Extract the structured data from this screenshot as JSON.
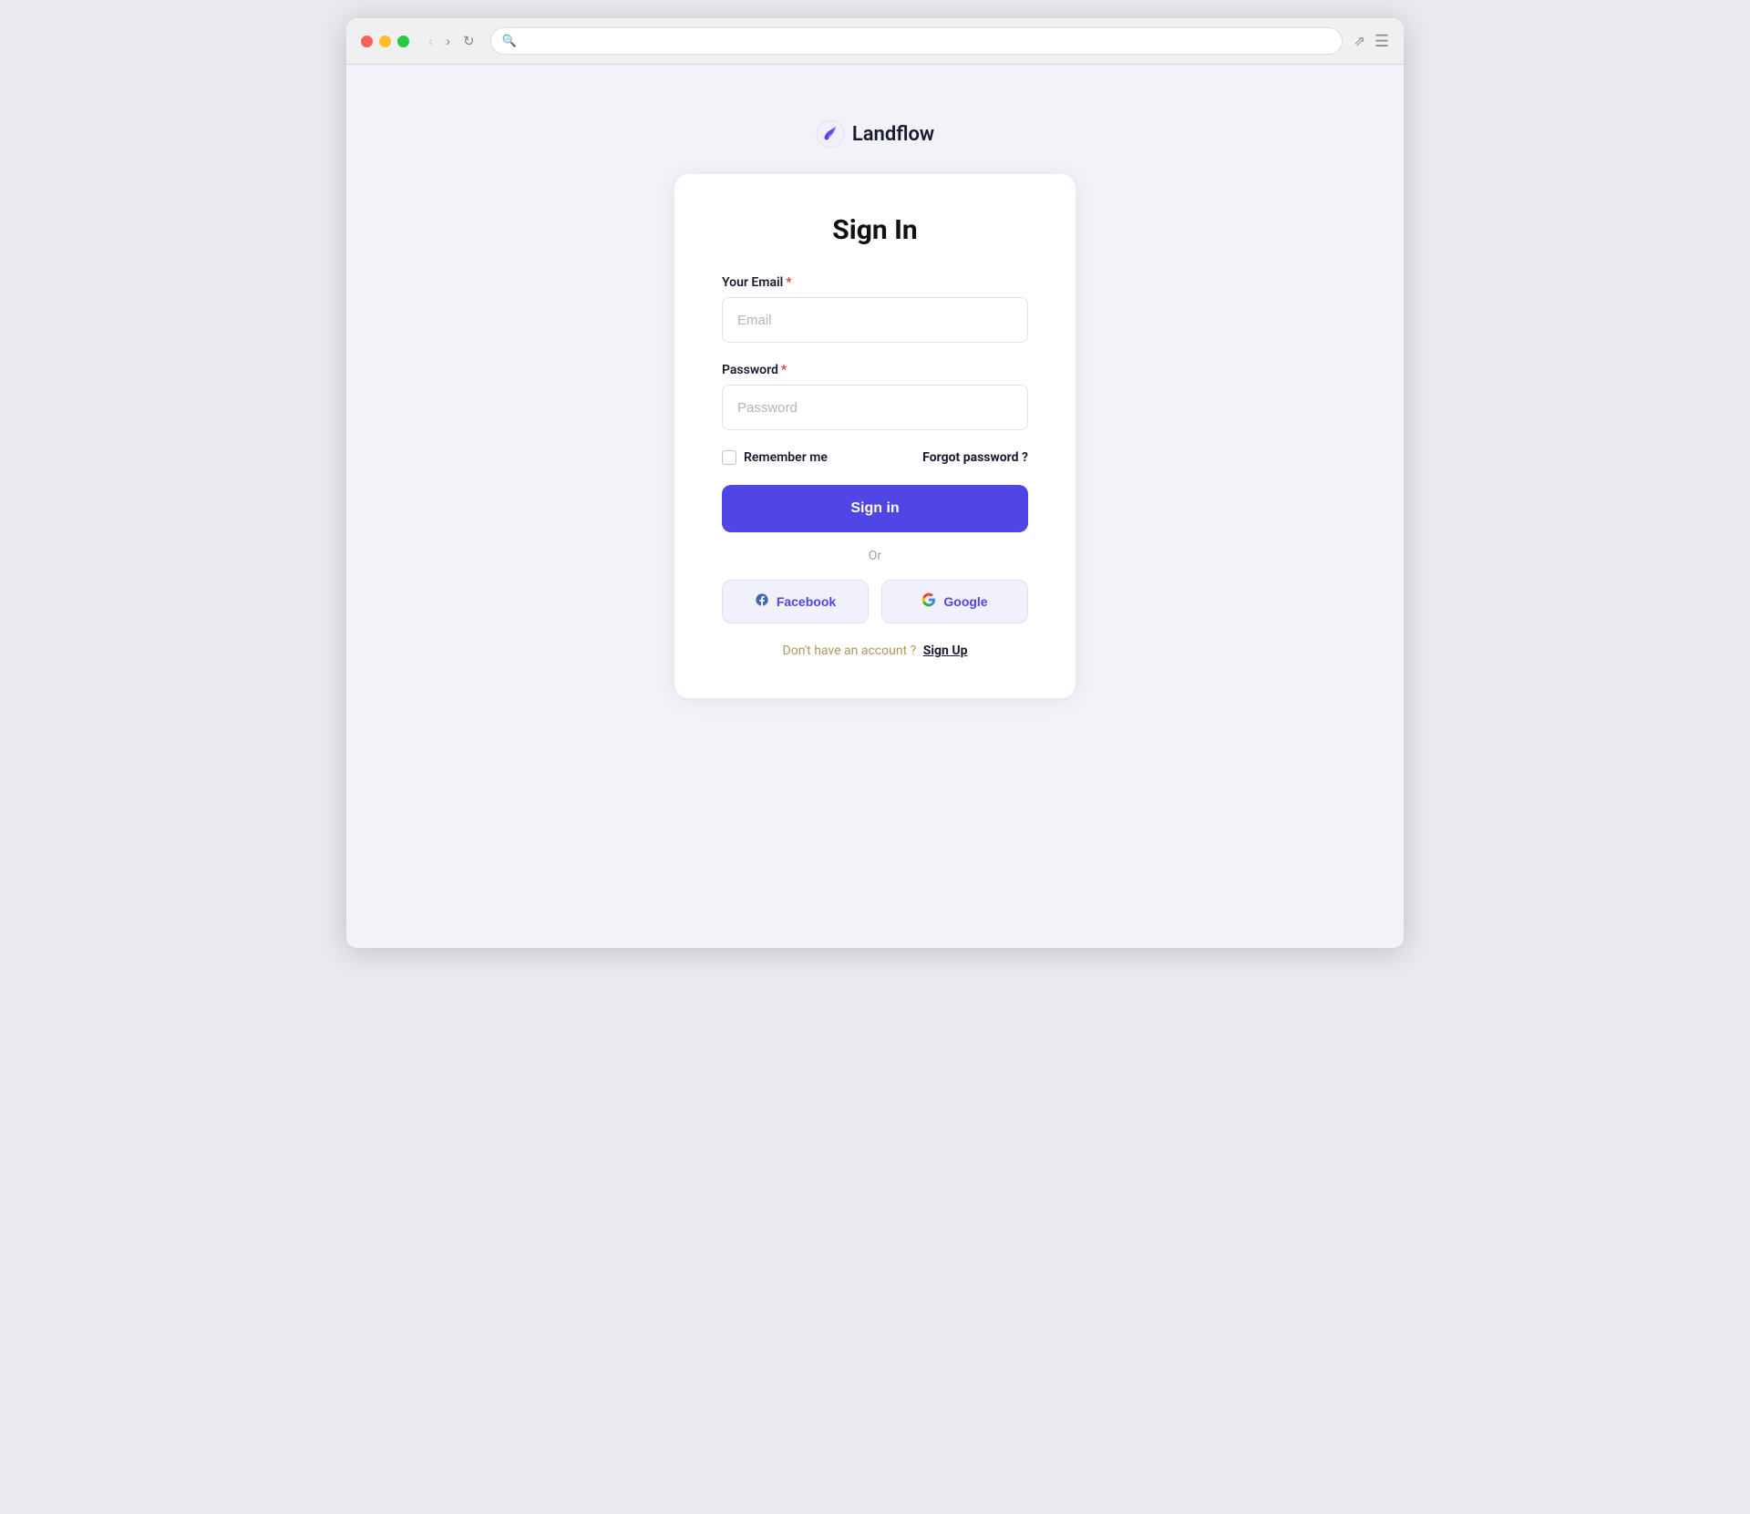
{
  "browser": {
    "traffic_lights": [
      "red",
      "yellow",
      "green"
    ],
    "nav_back_label": "‹",
    "nav_forward_label": "›",
    "nav_refresh_label": "↺",
    "address_placeholder": "",
    "expand_icon": "⤢",
    "menu_icon": "≡"
  },
  "logo": {
    "text": "Landflow",
    "icon_alt": "landflow-logo"
  },
  "form": {
    "title": "Sign In",
    "email_label": "Your Email",
    "email_placeholder": "Email",
    "password_label": "Password",
    "password_placeholder": "Password",
    "remember_me_label": "Remember me",
    "forgot_password_label": "Forgot password ?",
    "signin_button_label": "Sign in",
    "or_label": "Or",
    "facebook_button_label": "Facebook",
    "google_button_label": "Google",
    "no_account_text": "Don't have an account ?",
    "signup_link_label": "Sign Up"
  },
  "colors": {
    "accent": "#4f46e5",
    "required": "#e53935",
    "background": "#f1f3f8"
  }
}
